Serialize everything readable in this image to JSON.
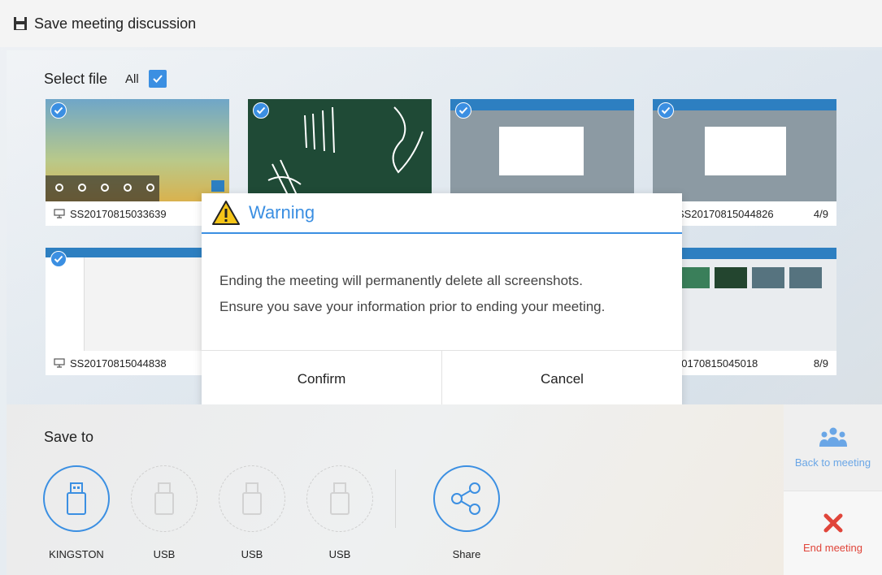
{
  "header": {
    "title": "Save meeting discussion",
    "icon": "save-icon"
  },
  "select": {
    "label": "Select file",
    "all_label": "All",
    "all_checked": true
  },
  "thumbnails": [
    {
      "name": "SS20170815033639",
      "page": ""
    },
    {
      "name": "",
      "page": ""
    },
    {
      "name": "",
      "page": ""
    },
    {
      "name": "SS20170815044826",
      "page": "4/9"
    },
    {
      "name": "SS20170815044838",
      "page": ""
    },
    {
      "name": "AN20170815045018",
      "page": "8/9"
    }
  ],
  "dialog": {
    "title": "Warning",
    "icon": "warning-icon",
    "line1": "Ending the meeting will permanently delete all screenshots.",
    "line2": "Ensure you save your information prior to ending your meeting.",
    "confirm": "Confirm",
    "cancel": "Cancel"
  },
  "save_to": {
    "label": "Save to",
    "drives": [
      {
        "label": "KINGSTON",
        "active": true
      },
      {
        "label": "USB",
        "active": false
      },
      {
        "label": "USB",
        "active": false
      },
      {
        "label": "USB",
        "active": false
      }
    ],
    "share_label": "Share"
  },
  "side": {
    "back_label": "Back to meeting",
    "end_label": "End meeting"
  },
  "colors": {
    "accent": "#3b8fe2",
    "danger": "#e0453a"
  }
}
